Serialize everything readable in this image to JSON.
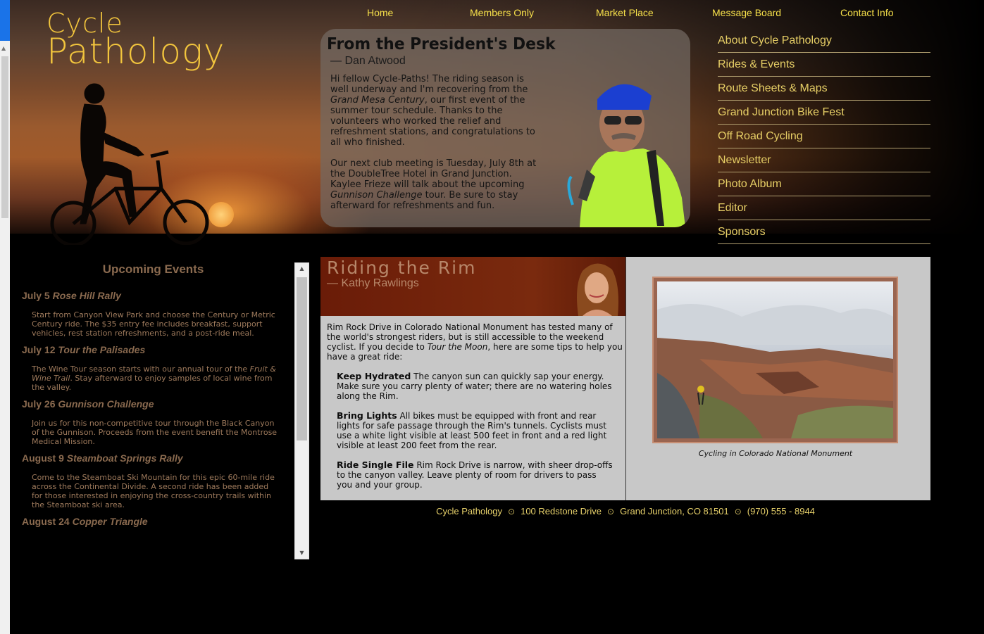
{
  "colors": {
    "accent": "#f6e04a",
    "nav_gold": "#e7cf66",
    "events_brown": "#8a6a4f",
    "article_header": "#6a1c08",
    "panel_gray": "#c8c8c8"
  },
  "logo": {
    "line1": "Cycle",
    "line2": "Pathology"
  },
  "top_nav": [
    {
      "label": "Home"
    },
    {
      "label": "Members Only"
    },
    {
      "label": "Market Place"
    },
    {
      "label": "Message Board"
    },
    {
      "label": "Contact Info"
    }
  ],
  "president": {
    "title": "From the President's Desk",
    "byline": "— Dan Atwood",
    "p1_a": "Hi fellow Cycle-Paths! The riding season is well underway and I'm recovering from the ",
    "p1_em": "Grand Mesa Century",
    "p1_b": ", our first event of the summer tour schedule. Thanks to the volunteers who worked the relief and refreshment stations, and congratulations to all who finished.",
    "p2_a": "Our next club meeting is Tuesday, July 8th at the DoubleTree Hotel in Grand Junction. Kaylee Frieze will talk about the upcoming ",
    "p2_em": "Gunnison Challenge",
    "p2_b": " tour. Be sure to stay afterward for refreshments and fun."
  },
  "side_nav": [
    {
      "label": "About Cycle Pathology"
    },
    {
      "label": "Rides & Events"
    },
    {
      "label": "Route Sheets & Maps"
    },
    {
      "label": "Grand Junction Bike Fest"
    },
    {
      "label": "Off Road Cycling"
    },
    {
      "label": "Newsletter"
    },
    {
      "label": "Photo Album"
    },
    {
      "label": "Editor"
    },
    {
      "label": "Sponsors"
    }
  ],
  "events": {
    "heading": "Upcoming Events",
    "items": [
      {
        "date": "July 5",
        "name": "Rose Hill Rally",
        "desc": "Start from Canyon View Park and choose the Century or Metric Century ride. The $35 entry fee includes breakfast, support vehicles, rest station refreshments, and a post-ride meal."
      },
      {
        "date": "July 12",
        "name": "Tour the Palisades",
        "desc_a": "The Wine Tour season starts with our annual tour of the ",
        "desc_em": "Fruit & Wine Trail",
        "desc_b": ". Stay afterward to enjoy samples of local wine from the valley."
      },
      {
        "date": "July 26",
        "name": "Gunnison Challenge",
        "desc": "Join us for this non-competitive tour through the Black Canyon of the Gunnison. Proceeds from the event benefit the Montrose Medical Mission."
      },
      {
        "date": "August 9",
        "name": "Steamboat Springs Rally",
        "desc": "Come to the Steamboat Ski Mountain for this epic 60-mile ride across the Continental Divide. A second ride has been added for those interested in enjoying the cross-country trails within the Steamboat ski area."
      },
      {
        "date": "August 24",
        "name": "Copper Triangle"
      }
    ]
  },
  "article": {
    "title": "Riding the Rim",
    "byline": "— Kathy Rawlings",
    "intro_a": "Rim Rock Drive in Colorado National Monument has tested many of the world's strongest riders, but is still accessible to the weekend cyclist. If you decide to ",
    "intro_em": "Tour the Moon",
    "intro_b": ", here are some tips to help you have a great ride:",
    "tips": [
      {
        "head": "Keep Hydrated",
        "text": " The canyon sun can quickly sap your energy. Make sure you carry plenty of water; there are no watering holes along the Rim."
      },
      {
        "head": "Bring Lights",
        "text": " All bikes must be equipped with front and rear lights for safe passage through the Rim's tunnels. Cyclists must use a white light visible at least 500 feet in front and a red light visible at least 200 feet from the rear."
      },
      {
        "head": "Ride Single File",
        "text": " Rim Rock Drive is narrow, with sheer drop-offs to the canyon valley. Leave plenty of room for drivers to pass you and your group."
      }
    ]
  },
  "photo": {
    "caption": "Cycling in Colorado National Monument"
  },
  "footer": {
    "name": "Cycle Pathology",
    "address": "100 Redstone Drive",
    "city": "Grand Junction, CO 81501",
    "phone": "(970) 555 - 8944",
    "sep": "⊙"
  }
}
